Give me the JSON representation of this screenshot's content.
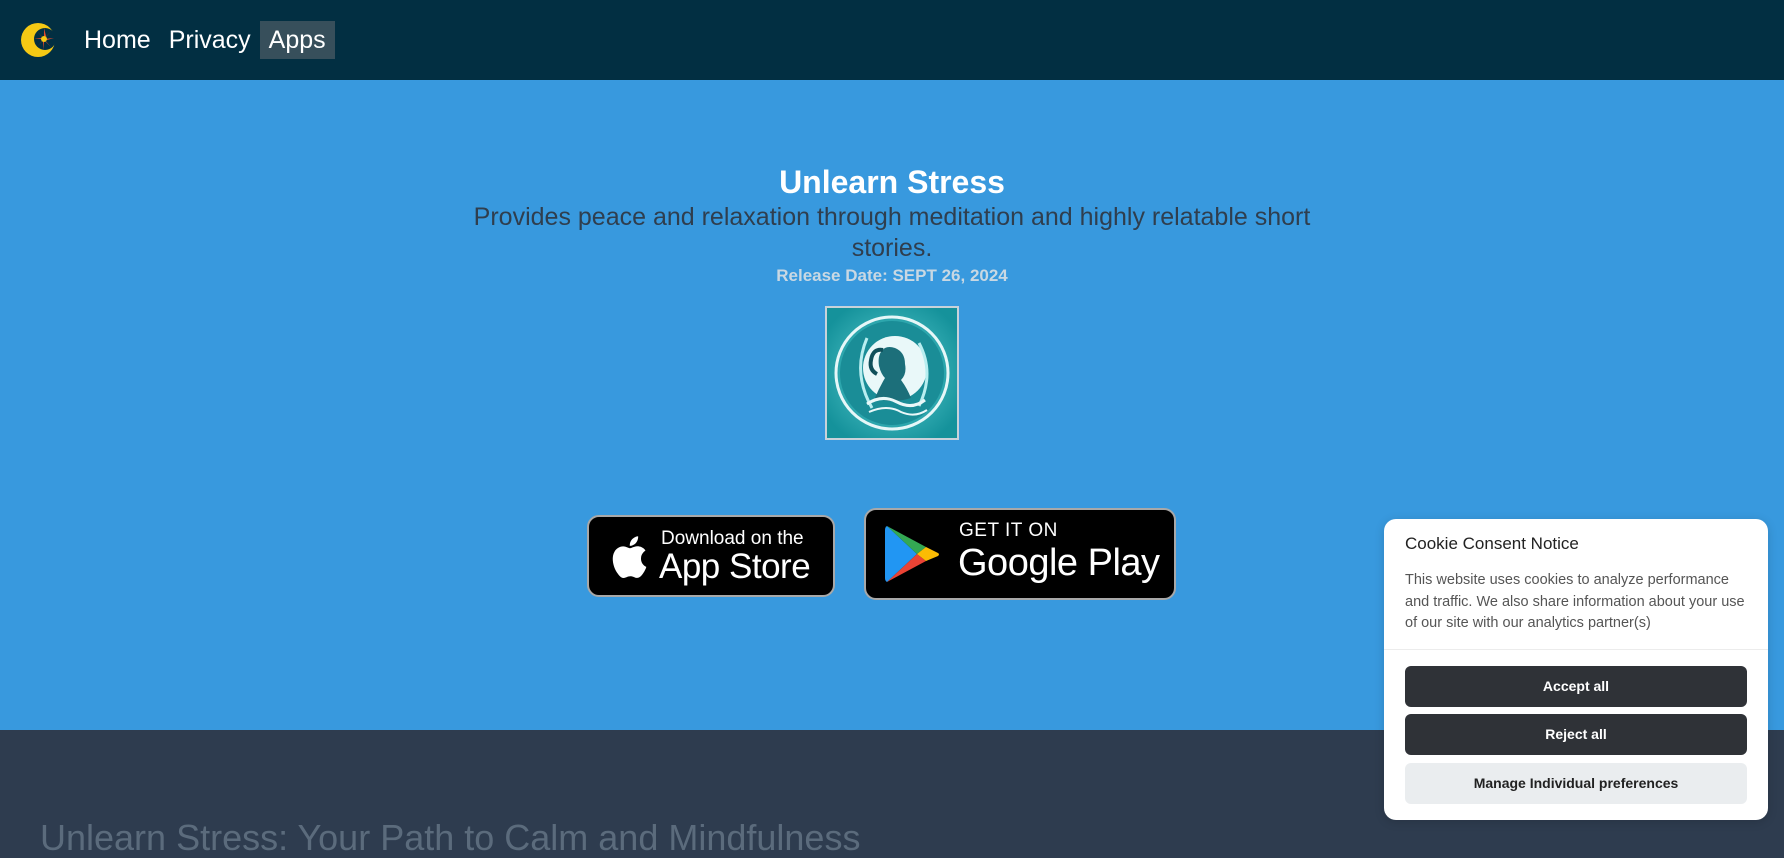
{
  "nav": {
    "logo_icon": "sun-burst-logo-icon",
    "links": [
      {
        "label": "Home"
      },
      {
        "label": "Privacy"
      },
      {
        "label": "Apps"
      }
    ],
    "active": "Apps"
  },
  "hero": {
    "title": "Unlearn Stress",
    "description": "Provides peace and relaxation through meditation and highly relatable short stories.",
    "release": "Release Date: SEPT 26, 2024",
    "app_icon": "meditating-woman-app-icon"
  },
  "stores": {
    "appstore": {
      "small": "Download on the",
      "big": "App Store",
      "icon": "apple-icon"
    },
    "googleplay": {
      "small": "GET IT ON",
      "big": "Google Play",
      "icon": "google-play-icon"
    }
  },
  "section": {
    "title": "Unlearn Stress: Your Path to Calm and Mindfulness"
  },
  "cookie": {
    "title": "Cookie Consent Notice",
    "text": "This website uses cookies to analyze performance and traffic. We also share information about your use of our site with our analytics partner(s)",
    "accept": "Accept all",
    "reject": "Reject all",
    "manage": "Manage Individual preferences"
  },
  "colors": {
    "navbar": "#022f42",
    "hero": "#3899de",
    "footer": "#2e3c4f",
    "button_dark": "#2f3237"
  }
}
